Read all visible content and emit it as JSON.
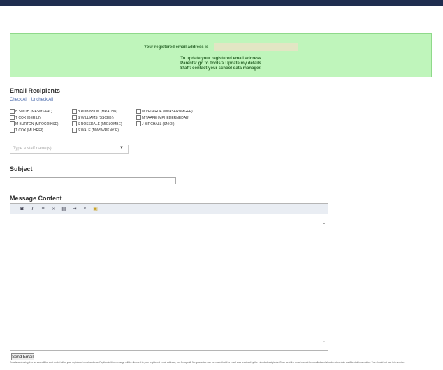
{
  "notice": {
    "line1": "Your registered email address is",
    "line2a": "To update your registered email address",
    "line2b": "Parents: go to Tools > Update my details",
    "line2c": "Staff: contact your school data manager."
  },
  "recipients": {
    "title": "Email Recipients",
    "check_all": "Check All",
    "uncheck_all": "Uncheck All",
    "items": [
      "B SMITH (MASMSAAL)",
      "T COX (BERILI)",
      "M BURTON (MPOCOIKSE)",
      "T COX (MUHREI)",
      "B ROBINSON (MRATHN)",
      "S WILLIAMS (SSCEBI)",
      "S ROSSDALE (MIGLOMBE)",
      "S WALE (MWSWRKNYIP)",
      "M VELARDE (MPASERNMGEP)",
      "M TAAFE (MPHEDERNEDAB)",
      "J BIRCHALL (SNIOI)"
    ],
    "select_placeholder": "Type a staff name(s)"
  },
  "subject": {
    "title": "Subject",
    "value": ""
  },
  "message": {
    "title": "Message Content",
    "toolbar": [
      "bold-icon",
      "italic-icon",
      "list-icon",
      "link-icon",
      "image-icon",
      "indent-icon",
      "find-icon",
      "paste-icon"
    ]
  },
  "send_button": "Send Email",
  "footer_text": "Emails sent using this service will be sent on behalf of your registered email address. Replies to this message will be directed to your registered email address, not Groupcall. No guarantee can be made that this email was received by the intended recipients. Once sent the email cannot be recalled and should not contain confidential information. You should not use this service."
}
